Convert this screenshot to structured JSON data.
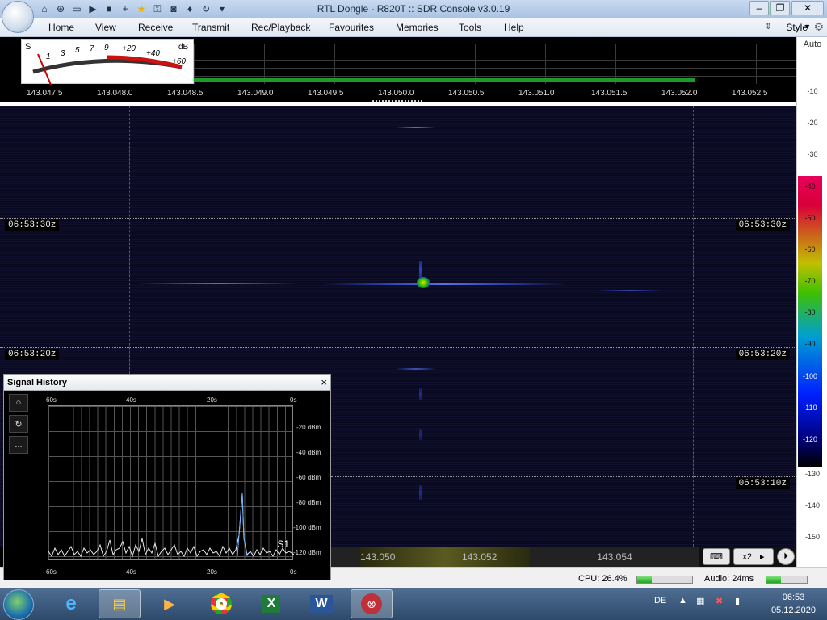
{
  "window": {
    "title": "RTL Dongle - R820T :: SDR Console v3.0.19",
    "quick_access": [
      "home-icon",
      "lifebuoy-icon",
      "folder-icon",
      "play-icon",
      "stop-icon",
      "add-icon",
      "star-icon",
      "lock-icon",
      "camera-icon",
      "drop-icon",
      "refresh-icon",
      "dropdown-icon"
    ]
  },
  "menu": {
    "items": [
      "Home",
      "View",
      "Receive",
      "Transmit",
      "Rec/Playback",
      "Favourites",
      "Memories",
      "Tools",
      "Help"
    ],
    "style_label": "Style"
  },
  "smeter": {
    "s_label": "S",
    "db_label": "dB",
    "scale_s": [
      "1",
      "3",
      "5",
      "7",
      "9"
    ],
    "scale_plus": [
      "+20",
      "+40",
      "+60"
    ]
  },
  "frequency_scale": {
    "labels": [
      "143.047.5",
      "143.048.0",
      "143.048.5",
      "143.049.0",
      "143.049.5",
      "143.050.0",
      "143.050.5",
      "143.051.0",
      "143.051.5",
      "143.052.0",
      "143.052.5"
    ]
  },
  "waterfall": {
    "time_labels": [
      "06:53:30z",
      "06:53:20z",
      "06:53:10z"
    ]
  },
  "db_scale": {
    "auto_label": "Auto",
    "ticks": [
      "-10",
      "-20",
      "-30",
      "-40",
      "-50",
      "-60",
      "-70",
      "-80",
      "-90",
      "-100",
      "-110",
      "-120",
      "-130",
      "-140",
      "-150"
    ]
  },
  "signal_history": {
    "title": "Signal History",
    "close": "×",
    "buttons": [
      "○",
      "↻",
      "..."
    ],
    "top_labels": [
      "60s",
      "40s",
      "20s",
      "0s"
    ],
    "bottom_labels": [
      "60s",
      "40s",
      "20s",
      "0s"
    ],
    "dbm_labels": [
      "-20 dBm",
      "-40 dBm",
      "-60 dBm",
      "-80 dBm",
      "-100 dBm",
      "-120 dBm"
    ],
    "s_label": "S1"
  },
  "bottom_nav": {
    "freq1": "143.050",
    "freq2": "143.052",
    "freq3": "143.054",
    "zoom": "x2"
  },
  "status": {
    "cpu": "CPU: 26.4%",
    "audio": "Audio: 24ms",
    "cpu_level": 0.26,
    "audio_level": 0.35
  },
  "taskbar": {
    "language": "DE",
    "time": "06:53",
    "date": "05.12.2020"
  }
}
